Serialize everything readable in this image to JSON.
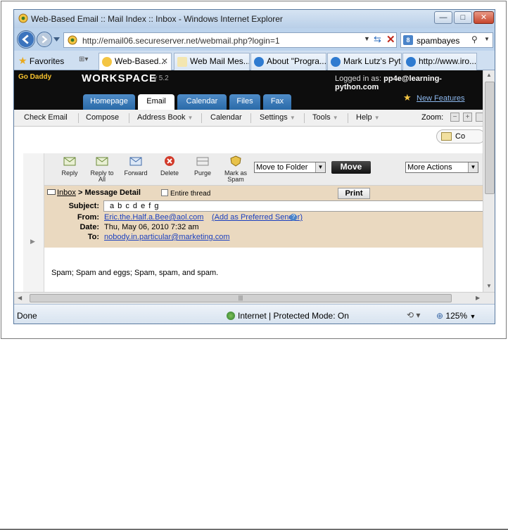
{
  "window": {
    "title": "Web-Based Email :: Mail Index :: Inbox - Windows Internet Explorer",
    "minimize": "—",
    "maximize": "□",
    "close": "✕"
  },
  "address": {
    "url": "http://email06.secureserver.net/webmail.php?login=1",
    "search_value": "spambayes"
  },
  "favorites": {
    "label": "Favorites"
  },
  "browser_tabs": [
    {
      "label": "Web-Based...",
      "active": true
    },
    {
      "label": "Web Mail Mes..."
    },
    {
      "label": "About \"Progra..."
    },
    {
      "label": "Mark Lutz's Pyt..."
    },
    {
      "label": "http://www.iro..."
    }
  ],
  "app": {
    "logo": "Go Daddy",
    "name": "WORKSPACE",
    "version": "v 5.2",
    "logged_in_prefix": "Logged in as:",
    "logged_in_user": "pp4e@learning-python.com",
    "tabs": [
      "Homepage",
      "Email",
      "Calendar",
      "Files",
      "Fax"
    ],
    "new_features": "New Features"
  },
  "menu": {
    "items": [
      "Check Email",
      "Compose",
      "Address Book",
      "Calendar",
      "Settings",
      "Tools",
      "Help"
    ],
    "zoom_label": "Zoom:",
    "co_label": "Co"
  },
  "actions": {
    "reply": "Reply",
    "reply_all_1": "Reply to",
    "reply_all_2": "All",
    "forward": "Forward",
    "delete": "Delete",
    "purge": "Purge",
    "spam_1": "Mark as",
    "spam_2": "Spam",
    "move_to_folder": "Move to Folder",
    "move": "Move",
    "more_actions": "More Actions"
  },
  "message": {
    "breadcrumb_inbox": "Inbox",
    "breadcrumb_rest": " > Message Detail",
    "entire_thread": "Entire thread",
    "print": "Print",
    "subject_label": "Subject:",
    "subject": "a b c d e f g",
    "from_label": "From:",
    "from": "Eric.the.Half.a.Bee@aol.com",
    "add_sender": "(Add as Preferred Sender)",
    "date_label": "Date:",
    "date": "Thu, May 06, 2010 7:32 am",
    "to_label": "To:",
    "to": "nobody.in.particular@marketing.com",
    "body": "Spam; Spam and eggs; Spam, spam, and spam."
  },
  "status": {
    "left": "Done",
    "zone": "Internet | Protected Mode: On",
    "zoom": "125%"
  }
}
